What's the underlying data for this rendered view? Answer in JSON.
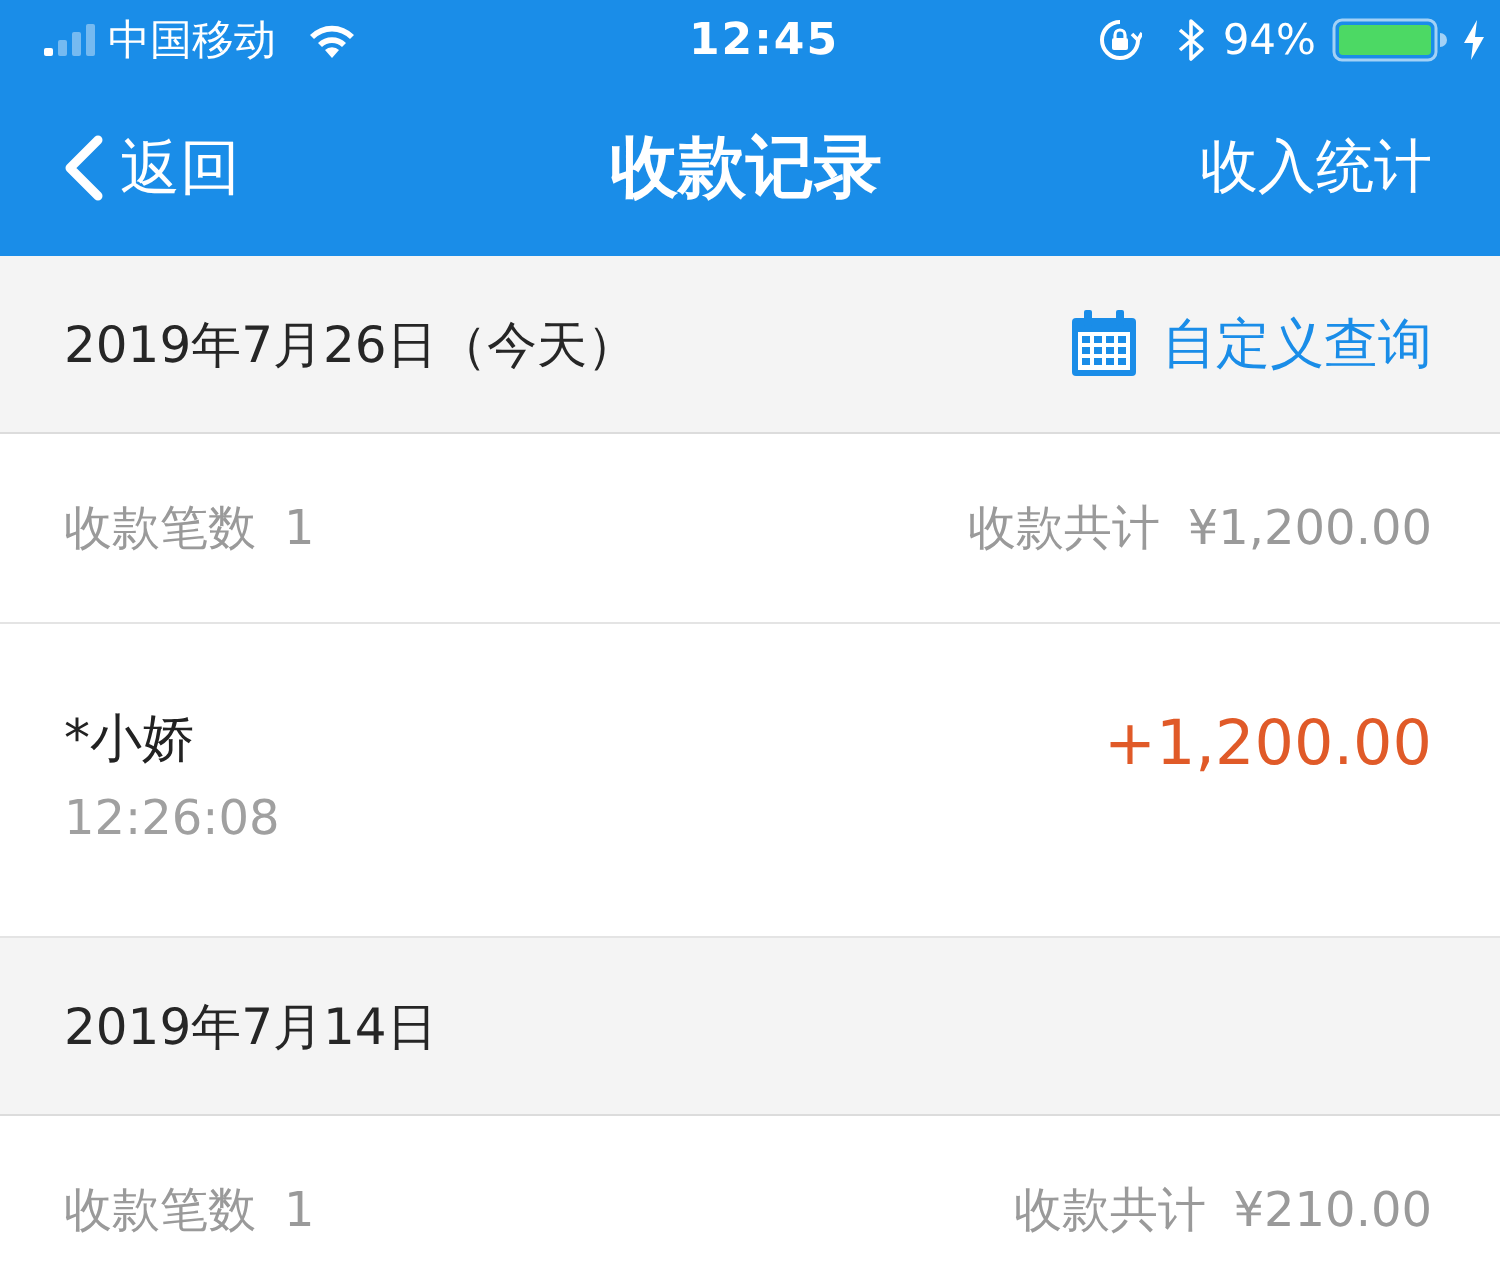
{
  "status_bar": {
    "carrier": "中国移动",
    "time": "12:45",
    "battery": "94%"
  },
  "nav_bar": {
    "back": "返回",
    "title": "收款记录",
    "action": "收入统计"
  },
  "groups": [
    {
      "date": "2019年7月26日（今天）",
      "query": "自定义查询",
      "count_label": "收款笔数",
      "count": "1",
      "total_label": "收款共计",
      "total": "¥1,200.00",
      "transactions": [
        {
          "name": "*小娇",
          "time": "12:26:08",
          "amount": "+1,200.00"
        }
      ]
    },
    {
      "date": "2019年7月14日",
      "count_label": "收款笔数",
      "count": "1",
      "total_label": "收款共计",
      "total": "¥210.00"
    }
  ]
}
